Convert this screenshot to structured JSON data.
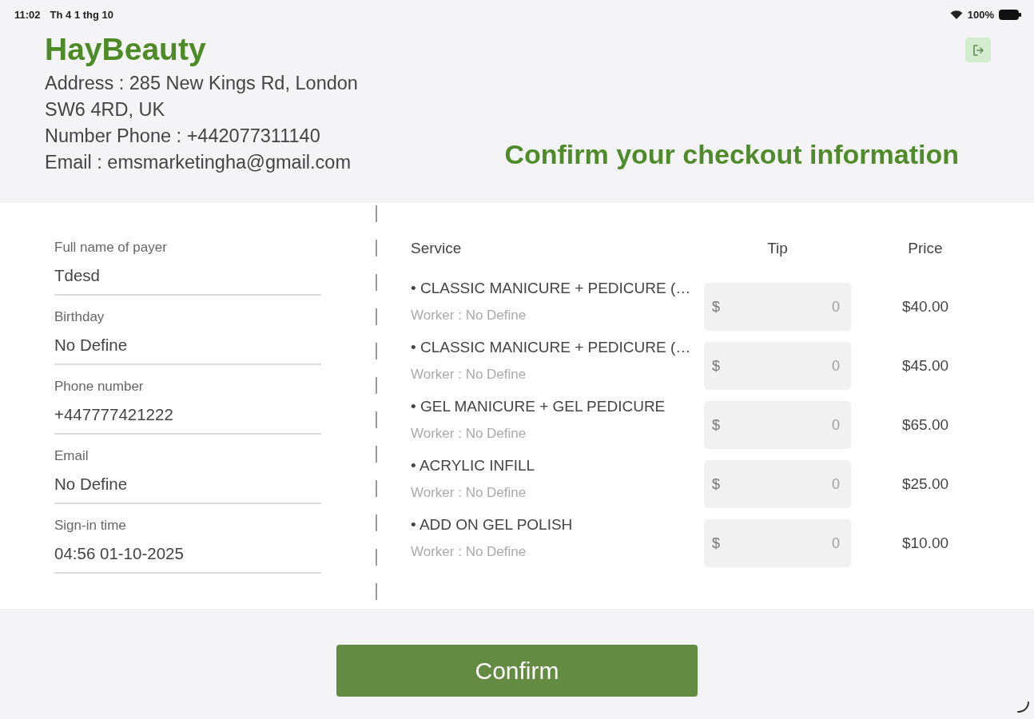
{
  "status_bar": {
    "time": "11:02",
    "date": "Th 4 1 thg 10",
    "battery": "100%"
  },
  "header": {
    "brand": "HayBeauty",
    "address": "Address : 285 New Kings Rd, London SW6 4RD, UK",
    "phone": "Number Phone : +442077311140",
    "email": "Email : emsmarketingha@gmail.com",
    "title": "Confirm your checkout information"
  },
  "customer": {
    "fields": [
      {
        "label": "Full name of payer",
        "value": "Tdesd"
      },
      {
        "label": "Birthday",
        "value": "No Define"
      },
      {
        "label": "Phone number",
        "value": "+447777421222"
      },
      {
        "label": "Email",
        "value": "No Define"
      },
      {
        "label": "Sign-in time",
        "value": "04:56 01-10-2025"
      }
    ]
  },
  "services": {
    "columns": [
      "Service",
      "Tip",
      "Price"
    ],
    "rows": [
      {
        "name": "• CLASSIC MANICURE + PEDICURE (…",
        "worker": "Worker : No Define",
        "tip_prefix": "$",
        "tip_placeholder": "0",
        "price": "$40.00"
      },
      {
        "name": "• CLASSIC MANICURE + PEDICURE (…",
        "worker": "Worker : No Define",
        "tip_prefix": "$",
        "tip_placeholder": "0",
        "price": "$45.00"
      },
      {
        "name": "• GEL MANICURE + GEL PEDICURE",
        "worker": "Worker : No Define",
        "tip_prefix": "$",
        "tip_placeholder": "0",
        "price": "$65.00"
      },
      {
        "name": "• ACRYLIC INFILL",
        "worker": "Worker : No Define",
        "tip_prefix": "$",
        "tip_placeholder": "0",
        "price": "$25.00"
      },
      {
        "name": "• ADD ON GEL POLISH",
        "worker": "Worker : No Define",
        "tip_prefix": "$",
        "tip_placeholder": "0",
        "price": "$10.00"
      }
    ]
  },
  "confirm_button": "Confirm"
}
